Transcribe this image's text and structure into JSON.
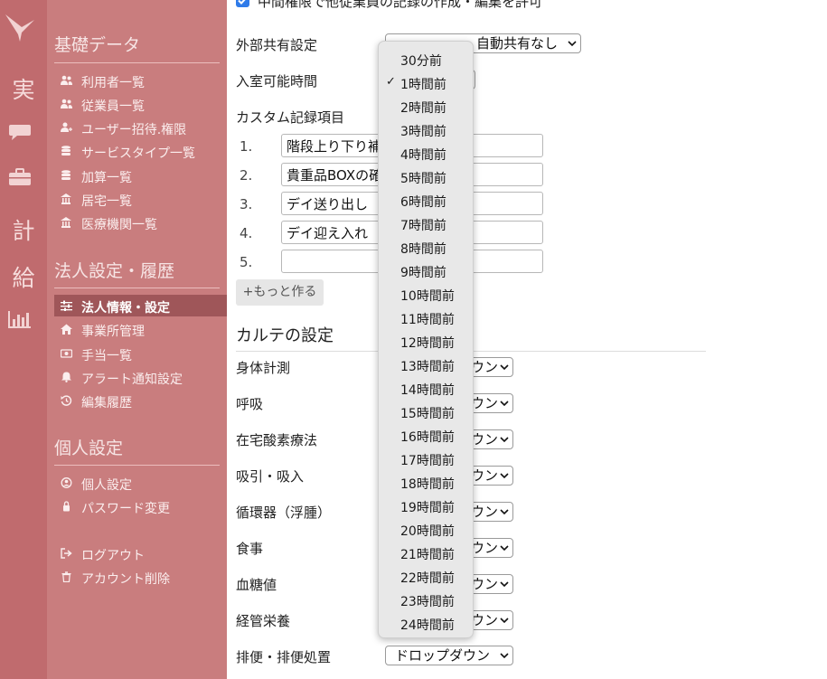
{
  "rail": {
    "items": [
      {
        "type": "text",
        "label": "実"
      },
      {
        "type": "icon",
        "icon": "chat-icon"
      },
      {
        "type": "icon",
        "icon": "briefcase-icon"
      },
      {
        "type": "text",
        "label": "計"
      },
      {
        "type": "text",
        "label": "給"
      },
      {
        "type": "icon",
        "icon": "bar-chart-icon"
      }
    ]
  },
  "sidebar": {
    "sections": [
      {
        "title": "基礎データ",
        "items": [
          {
            "label": "利用者一覧",
            "icon": "users-icon"
          },
          {
            "label": "従業員一覧",
            "icon": "users-icon"
          },
          {
            "label": "ユーザー招待.権限",
            "icon": "user-plus-icon"
          },
          {
            "label": "サービスタイプ一覧",
            "icon": "database-icon"
          },
          {
            "label": "加算一覧",
            "icon": "database-icon"
          },
          {
            "label": "居宅一覧",
            "icon": "building-icon"
          },
          {
            "label": "医療機関一覧",
            "icon": "building-icon"
          }
        ]
      },
      {
        "title": "法人設定・履歴",
        "items": [
          {
            "label": "法人情報・設定",
            "icon": "sliders-icon",
            "active": true
          },
          {
            "label": "事業所管理",
            "icon": "home-icon"
          },
          {
            "label": "手当一覧",
            "icon": "money-icon"
          },
          {
            "label": "アラート通知設定",
            "icon": "bell-icon"
          },
          {
            "label": "編集履歴",
            "icon": "history-icon"
          }
        ]
      },
      {
        "title": "個人設定",
        "items": [
          {
            "label": "個人設定",
            "icon": "user-circle-icon"
          },
          {
            "label": "パスワード変更",
            "icon": "lock-icon"
          }
        ]
      }
    ],
    "footer": [
      {
        "label": "ログアウト",
        "icon": "logout-icon"
      },
      {
        "label": "アカウント削除",
        "icon": "trash-icon"
      }
    ]
  },
  "main": {
    "top_checkbox_text": "中間権限で他従業員の記録の作成・編集を許可",
    "external_share": {
      "label": "外部共有設定",
      "value": "自動共有なし"
    },
    "entry_time": {
      "label": "入室可能時間"
    },
    "custom_records": {
      "label": "カスタム記録項目",
      "items": [
        {
          "num": "1.",
          "value": "階段上り下り補"
        },
        {
          "num": "2.",
          "value": "貴重品BOXの確"
        },
        {
          "num": "3.",
          "value": "デイ送り出し"
        },
        {
          "num": "4.",
          "value": "デイ迎え入れ"
        },
        {
          "num": "5.",
          "value": ""
        }
      ],
      "more_label": "+もっと作る"
    },
    "karte": {
      "title": "カルテの設定",
      "rows": [
        {
          "label": "身体計測",
          "value": "ウン"
        },
        {
          "label": "呼吸",
          "value": "ウン"
        },
        {
          "label": "在宅酸素療法",
          "value": "ウン"
        },
        {
          "label": "吸引・吸入",
          "value": "ウン"
        },
        {
          "label": "循環器（浮腫）",
          "value": "ウン"
        },
        {
          "label": "食事",
          "value": "ウン"
        },
        {
          "label": "血糖値",
          "value": "ウン"
        },
        {
          "label": "経管栄養",
          "value": "ウン"
        },
        {
          "label": "排便・排便処置",
          "value": "ドロップダウン"
        }
      ]
    }
  },
  "dropdown": {
    "selected_mark": "✓",
    "selected_index": 1,
    "options": [
      "30分前",
      "1時間前",
      "2時間前",
      "3時間前",
      "4時間前",
      "5時間前",
      "6時間前",
      "7時間前",
      "8時間前",
      "9時間前",
      "10時間前",
      "11時間前",
      "12時間前",
      "13時間前",
      "14時間前",
      "15時間前",
      "16時間前",
      "17時間前",
      "18時間前",
      "19時間前",
      "20時間前",
      "21時間前",
      "22時間前",
      "23時間前",
      "24時間前"
    ]
  },
  "colors": {
    "rail": "#c06b6e",
    "sidebar": "#c97d7e",
    "active": "#9f5659",
    "checkbox": "#2f7be9"
  }
}
